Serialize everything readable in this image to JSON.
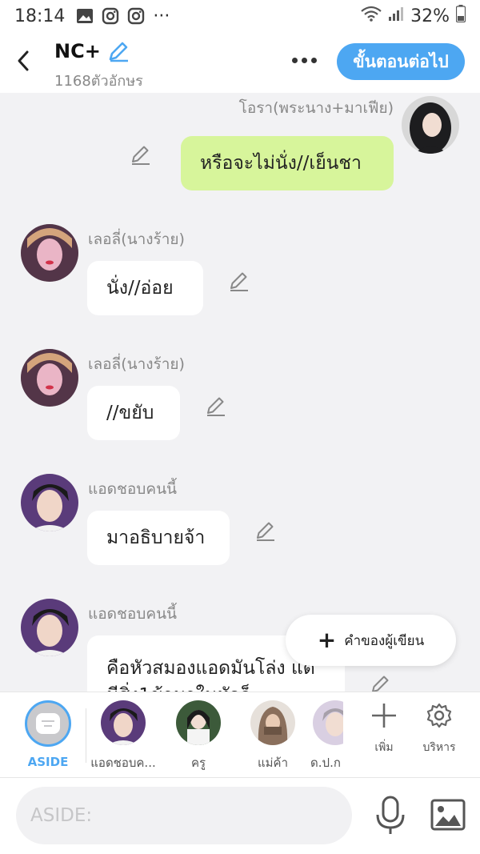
{
  "status": {
    "time": "18:14",
    "battery": "32%",
    "dots": "···"
  },
  "header": {
    "title": "NC+",
    "subtitle": "1168ตัวอักษร",
    "next_label": "ขั้นตอนต่อไป"
  },
  "messages": [
    {
      "sender": "โอรา(พระนาง+มาเฟีย)",
      "text": "หรือจะไม่นั่ง//เย็นชา",
      "mine": true
    },
    {
      "sender": "เลอลี่(นางร้าย)",
      "text": "นั่ง//อ่อย"
    },
    {
      "sender": "เลอลี่(นางร้าย)",
      "text": "//ขยับ"
    },
    {
      "sender": "แอดชอบคนนี้",
      "text": "มาอธิบายจ้า"
    },
    {
      "sender": "แอดชอบคนนี้",
      "text": "คือหัวสมองแอดมันโล่ง แต่มีสิ่ง1ข้ามาในหัวก็"
    }
  ],
  "fab": {
    "label": "คำของผู้เขียน"
  },
  "characters": [
    {
      "label": "ASIDE"
    },
    {
      "label": "แอดชอบค..."
    },
    {
      "label": "ครู"
    },
    {
      "label": "แม่ค้า"
    },
    {
      "label": "ด.ป.ก"
    }
  ],
  "tools": {
    "add_label": "เพิ่ม",
    "manage_label": "บริหาร"
  },
  "composer": {
    "placeholder": "ASIDE:"
  },
  "colors": {
    "accent": "#4da7f2",
    "mine_bubble": "#d7f59b",
    "background": "#f2f2f4"
  }
}
